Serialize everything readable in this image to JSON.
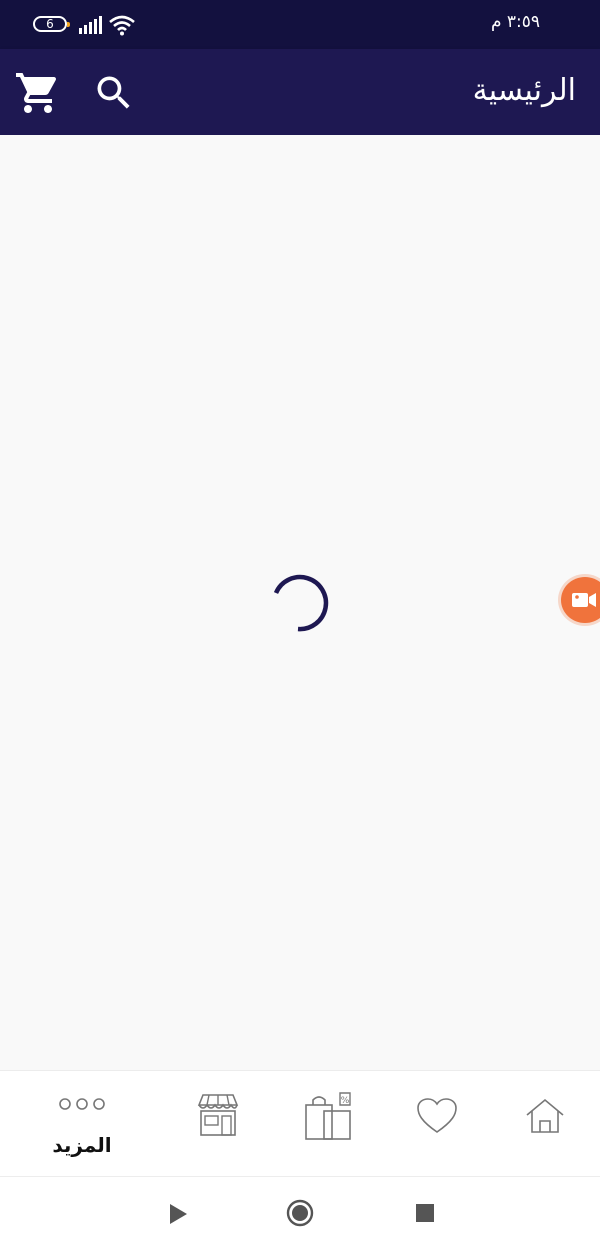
{
  "status_bar": {
    "time": "٣:٥٩ م",
    "battery_level": "6",
    "icons": [
      "battery-icon",
      "signal-icon",
      "wifi-icon"
    ]
  },
  "app_bar": {
    "title": "الرئيسية",
    "icons": [
      "cart-icon",
      "search-icon"
    ]
  },
  "content": {
    "state": "loading",
    "spinner_color": "#1e1852"
  },
  "bottom_nav": {
    "items": [
      {
        "icon": "more-dots-icon",
        "label": "المزيد"
      },
      {
        "icon": "store-icon",
        "label": ""
      },
      {
        "icon": "offers-bags-icon",
        "label": ""
      },
      {
        "icon": "heart-icon",
        "label": ""
      },
      {
        "icon": "home-icon",
        "label": ""
      }
    ]
  },
  "colors": {
    "primary": "#1e1852",
    "status_bar": "#13113f",
    "accent": "#f0733c"
  }
}
